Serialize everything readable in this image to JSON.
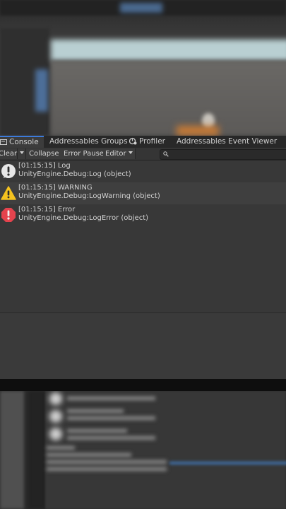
{
  "tabs": [
    {
      "label": "Console",
      "active": true
    },
    {
      "label": "Addressables Groups",
      "active": false
    },
    {
      "label": "Profiler",
      "active": false
    },
    {
      "label": "Addressables Event Viewer",
      "active": false
    }
  ],
  "toolbar": {
    "clear_label": "Clear",
    "collapse_label": "Collapse",
    "error_pause_label": "Error Pause",
    "editor_label": "Editor"
  },
  "entries": [
    {
      "type": "log",
      "line1": "[01:15:15] Log",
      "line2": "UnityEngine.Debug:Log (object)"
    },
    {
      "type": "warning",
      "line1": "[01:15:15] WARNING",
      "line2": "UnityEngine.Debug:LogWarning (object)"
    },
    {
      "type": "error",
      "line1": "[01:15:15] Error",
      "line2": "UnityEngine.Debug:LogError (object)"
    }
  ],
  "colors": {
    "log_icon": "#e6e6e6",
    "warning_icon": "#f4c21f",
    "error_icon": "#e5434d",
    "accent": "#3d7bdb"
  }
}
